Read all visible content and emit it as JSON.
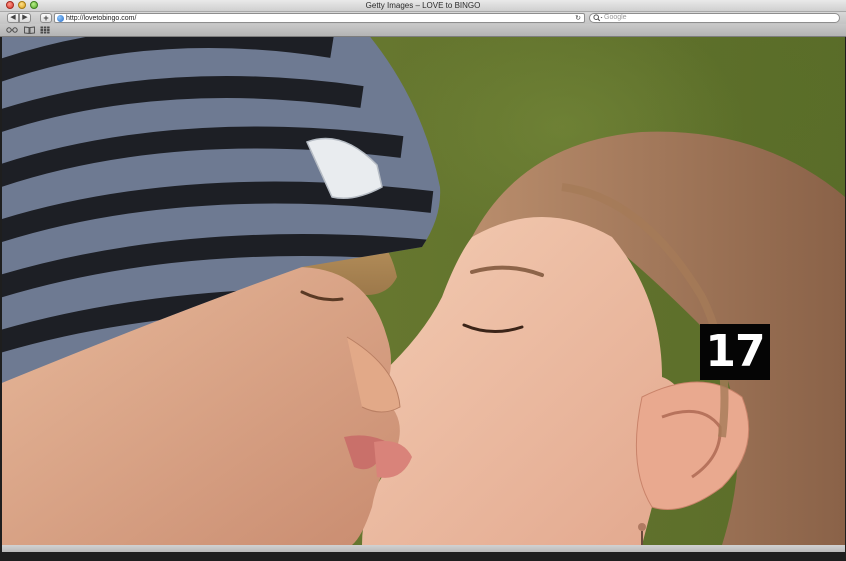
{
  "window": {
    "title": "Getty Images – LOVE to BINGO"
  },
  "toolbar": {
    "back_icon": "◀",
    "forward_icon": "▶",
    "add_icon": "+",
    "url": "http://lovetobingo.com/",
    "reload_icon": "↻",
    "search_placeholder": "Google",
    "search_value": ""
  },
  "content": {
    "number_badge": "17"
  },
  "icons": [
    "close-icon",
    "minimize-icon",
    "zoom-icon",
    "back-arrow-icon",
    "forward-arrow-icon",
    "add-bookmark-icon",
    "globe-icon",
    "reload-icon",
    "search-icon",
    "reading-list-icon",
    "bookmarks-book-icon",
    "top-sites-grid-icon"
  ],
  "colors": {
    "badge_bg": "#050505",
    "badge_text": "#ffffff",
    "background_green": "#5b6e2b"
  }
}
